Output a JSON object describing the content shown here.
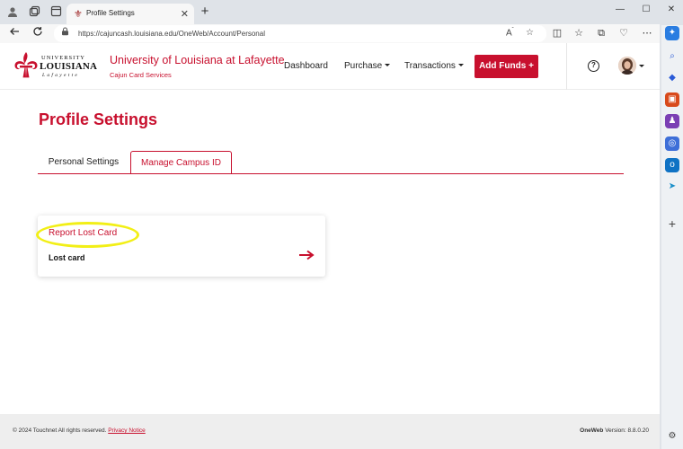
{
  "browser": {
    "tab_title": "Profile Settings",
    "url": "https://cajuncash.louisiana.edu/OneWeb/Account/Personal"
  },
  "site": {
    "logo": {
      "line1": "UNIVERSITY",
      "line2": "LOUISIANA",
      "line3": "Lafayette"
    },
    "title": "University of Louisiana at Lafayette",
    "subtitle": "Cajun Card Services",
    "menu": {
      "dashboard": "Dashboard",
      "purchase": "Purchase",
      "transactions": "Transactions"
    },
    "add_funds": "Add Funds +",
    "help_glyph": "?"
  },
  "main": {
    "page_title": "Profile Settings",
    "tabs": [
      {
        "label": "Personal Settings",
        "active": false
      },
      {
        "label": "Manage Campus ID",
        "active": true
      }
    ],
    "card": {
      "title": "Report Lost Card",
      "description": "Lost card"
    }
  },
  "footer": {
    "copyright": "© 2024 Touchnet All rights reserved.",
    "privacy": "Privacy Notice",
    "product": "OneWeb",
    "version": "Version: 8.8.0.20"
  },
  "colors": {
    "brand_red": "#c8102e",
    "highlight": "#f2ef16"
  }
}
